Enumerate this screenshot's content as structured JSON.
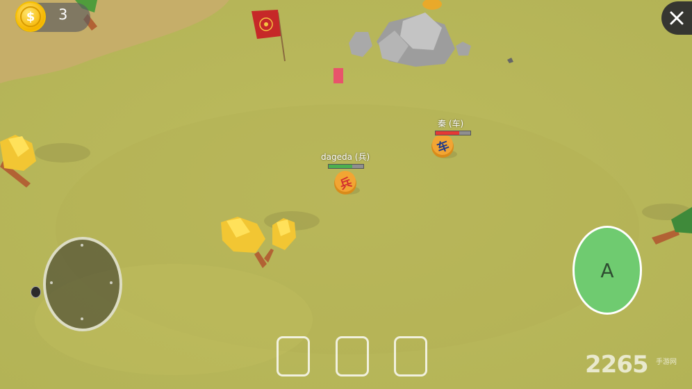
{
  "hud": {
    "coin_count": "3",
    "coin_symbol": "$",
    "close_icon": "close-icon",
    "action_button_label": "A"
  },
  "units": [
    {
      "name": "dageda (兵)",
      "piece_char": "兵",
      "hp": 0.67,
      "hp_color": "#4caf50"
    },
    {
      "name": "秦 (车)",
      "piece_char": "车",
      "hp": 0.67,
      "hp_color": "#e53935"
    }
  ],
  "banner": {
    "icon": "emblem-icon",
    "color": "#c62828"
  },
  "item_slots": [
    "",
    "",
    ""
  ],
  "watermark": {
    "text": "2265",
    "sub": "手游网"
  }
}
